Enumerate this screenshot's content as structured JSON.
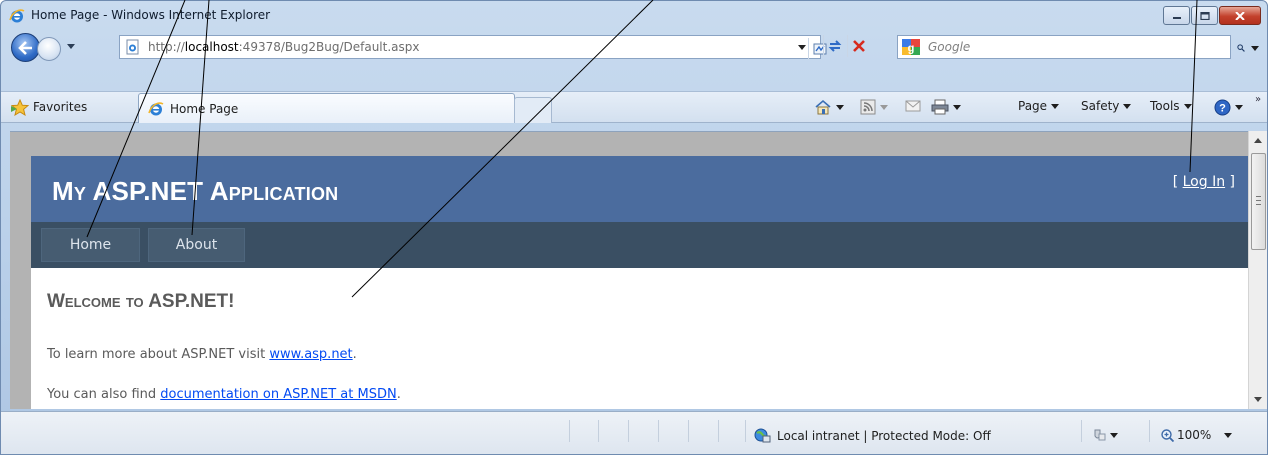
{
  "window": {
    "title": "Home Page - Windows Internet Explorer"
  },
  "address_bar": {
    "url_prefix": "http://",
    "url_host": "localhost",
    "url_rest": ":49378/Bug2Bug/Default.aspx",
    "search_placeholder": "Google"
  },
  "favorites_bar": {
    "favorites_label": "Favorites",
    "tab_label": "Home Page",
    "commands": {
      "page": "Page",
      "safety": "Safety",
      "tools": "Tools"
    }
  },
  "site": {
    "title": "My ASP.NET Application",
    "login_open": "[ ",
    "login_link": "Log In",
    "login_close": " ]",
    "menu": [
      {
        "label": "Home"
      },
      {
        "label": "About"
      }
    ],
    "heading": "Welcome to ASP.NET!",
    "para1_prefix": "To learn more about ASP.NET visit ",
    "para1_link": "www.asp.net",
    "para1_suffix": ".",
    "para2_prefix": "You can also find ",
    "para2_link": "documentation on ASP.NET at MSDN",
    "para2_suffix": "."
  },
  "status_bar": {
    "zone": "Local intranet | Protected Mode: Off",
    "zoom": "100%"
  },
  "colors": {
    "header": "#4b6c9e",
    "menubar": "#3a4f63",
    "link": "#034af3"
  }
}
